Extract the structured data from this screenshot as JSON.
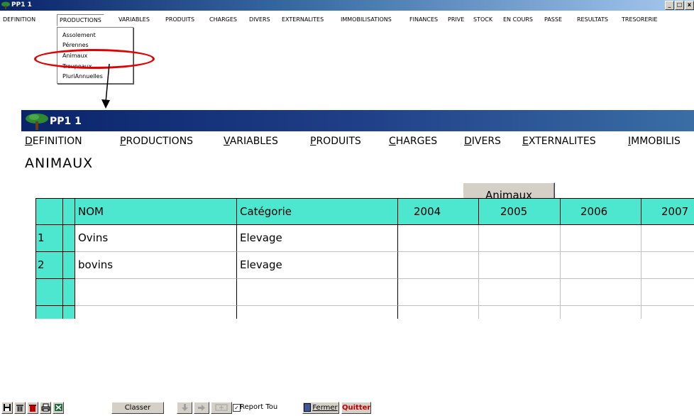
{
  "top_window": {
    "title": "PP1  1",
    "menu": [
      "DEFINITION",
      "PRODUCTIONS",
      "VARIABLES",
      "PRODUITS",
      "CHARGES",
      "DIVERS",
      "EXTERNALITES",
      "IMMOBILISATIONS",
      "FINANCES",
      "PRIVE",
      "STOCK",
      "EN COURS",
      "PASSE",
      "RESULTATS",
      "TRESORERIE"
    ],
    "active_menu": "PRODUCTIONS",
    "dropdown": [
      "Assolement",
      "Pérennes",
      "Animaux",
      "Troupeaux",
      "PluriAnnuelles"
    ],
    "highlighted_item": "Animaux",
    "window_buttons": [
      "_",
      "□",
      "x"
    ]
  },
  "main_window": {
    "title": "PP1  1",
    "menu": [
      "DEFINITION",
      "PRODUCTIONS",
      "VARIABLES",
      "PRODUITS",
      "CHARGES",
      "DIVERS",
      "EXTERNALITES",
      "IMMOBILIS"
    ],
    "section_title": "ANIMAUX",
    "animaux_button": "Animaux"
  },
  "grid": {
    "columns": [
      "NOM",
      "Catégorie",
      "2004",
      "2005",
      "2006",
      "2007"
    ],
    "rows": [
      {
        "num": "1",
        "nom": "Ovins",
        "categorie": "Elevage"
      },
      {
        "num": "2",
        "nom": "bovins",
        "categorie": "Elevage"
      },
      {
        "num": "",
        "nom": "",
        "categorie": ""
      },
      {
        "num": "",
        "nom": "",
        "categorie": ""
      }
    ]
  },
  "toolbar": {
    "classer": "Classer",
    "report": "Report Tou",
    "fermer": "Fermer",
    "quitter": "Quitter"
  },
  "colors": {
    "grid_header": "#4de6cf",
    "title_bar": "#0a246a",
    "highlight": "#e00000",
    "quitter": "#c00000"
  }
}
